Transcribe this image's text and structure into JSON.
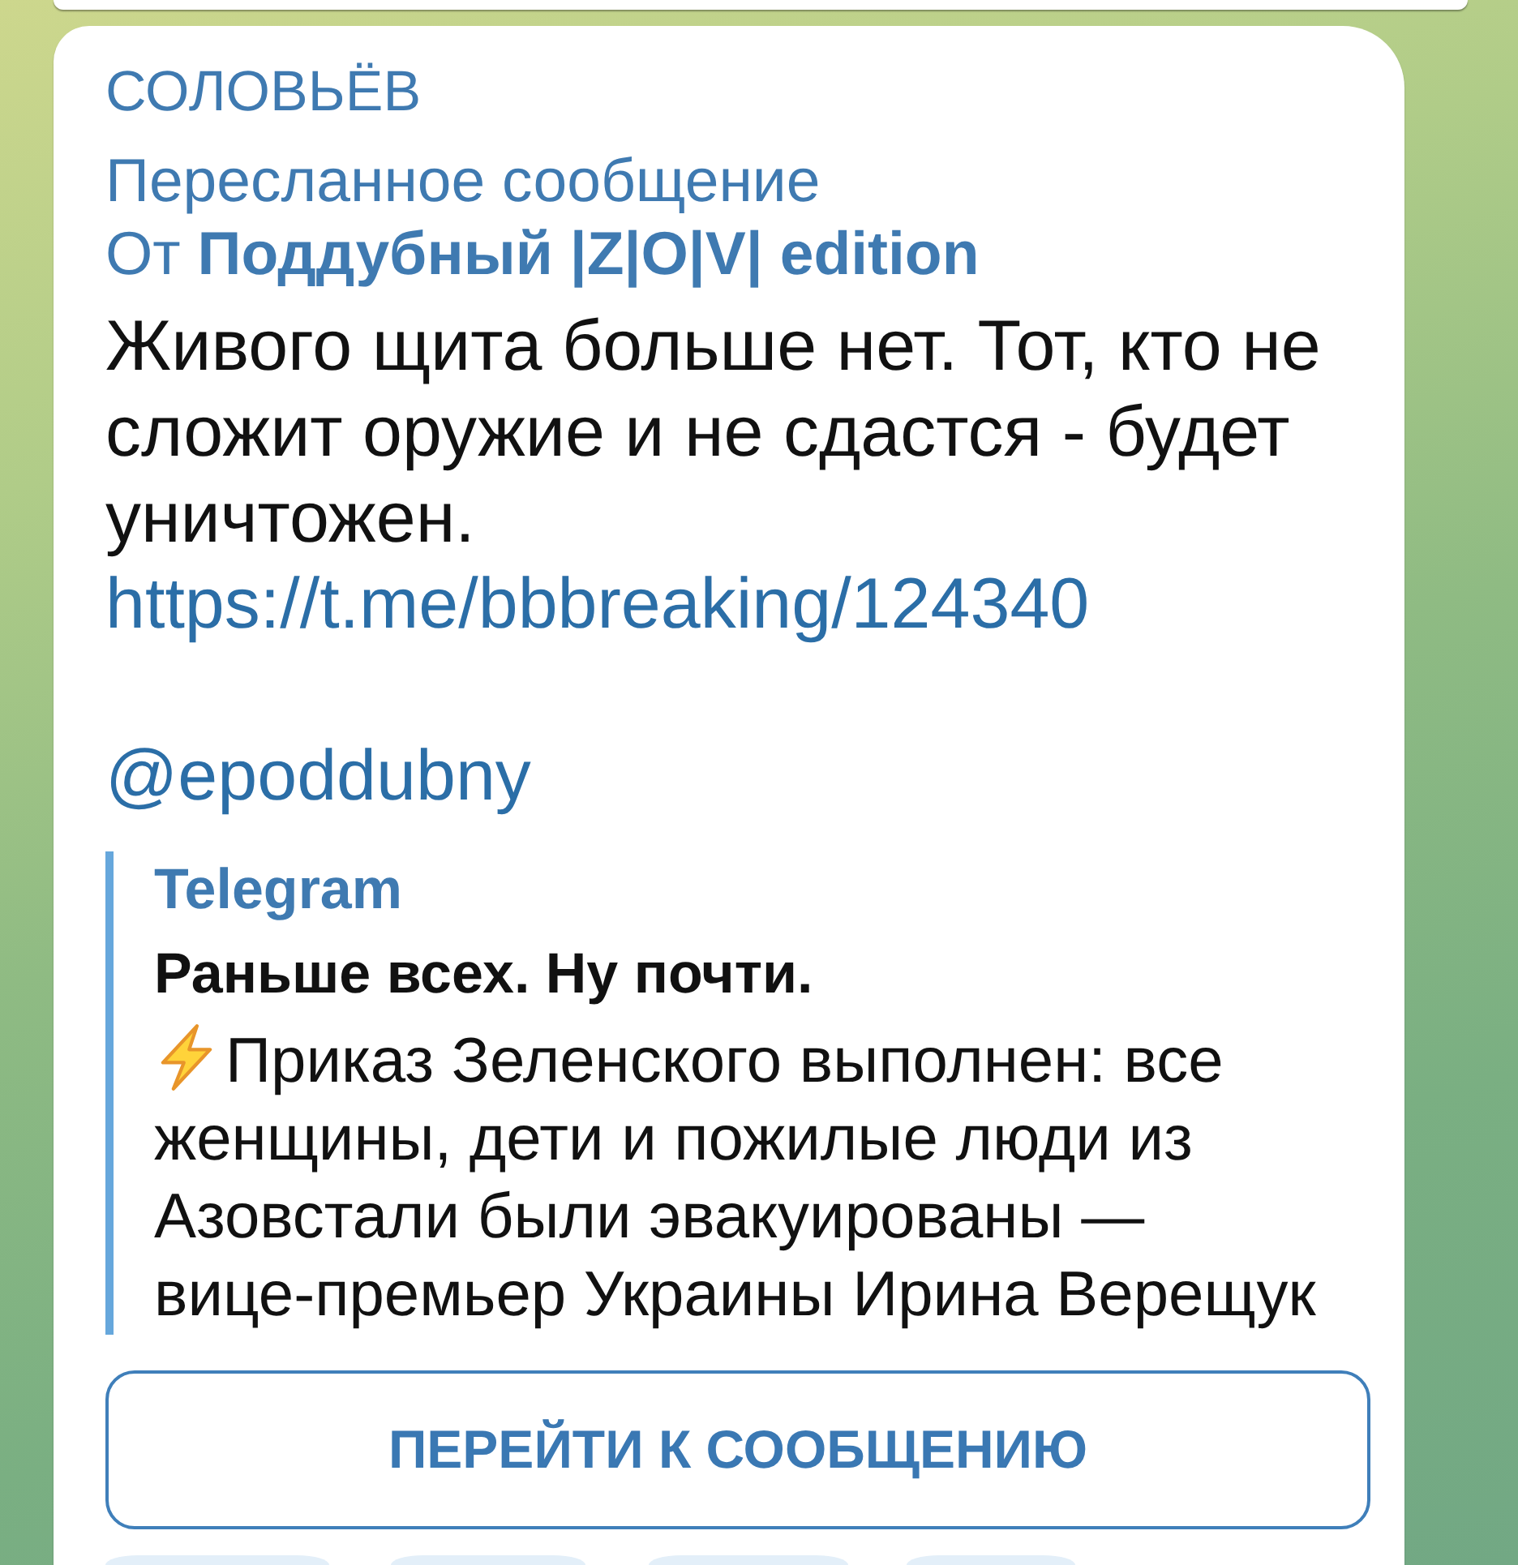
{
  "message": {
    "sender": "СОЛОВЬЁВ",
    "forward_label": "Пересланное сообщение",
    "forwarded_from": "От **Поддубный |Z|O|V| edition**",
    "text": "Живого щита больше нет. Тот, кто не сложит оружие и не сдастся - будет уничтожен.",
    "link": "https://t.me/bbbreaking/124340",
    "mention": "@epoddubny",
    "link_preview": {
      "site_name": "Telegram",
      "title": "Раньше всех. Ну почти.",
      "description": "Приказ Зеленского выполнен: все женщины, дети и пожилые люди из Азовстали были эвакуированы — вице-премьер Украины Ирина Верещук"
    }
  },
  "button": {
    "label": "ПЕРЕЙТИ К СООБЩЕНИЮ"
  }
}
